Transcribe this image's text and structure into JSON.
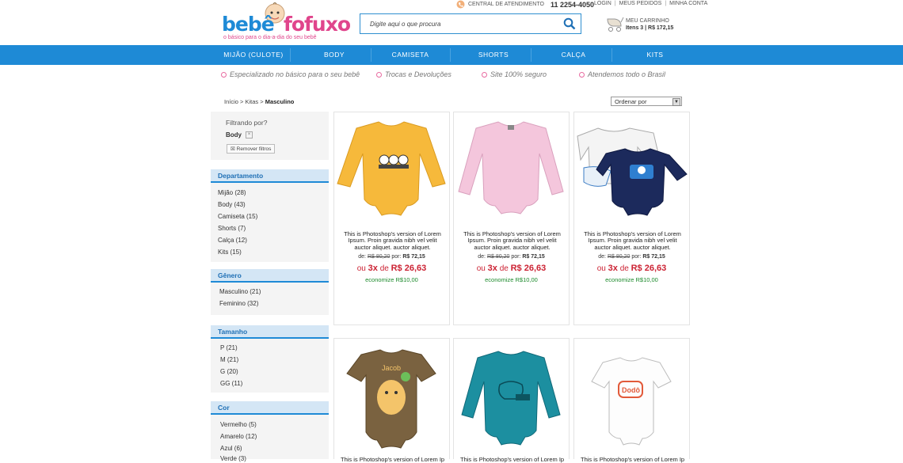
{
  "brand": {
    "part1": "bebê",
    "part2": "fofuxo",
    "tagline": "o básico para o dia-a-dia do seu bebê",
    "color1": "#1e8ad6",
    "color2": "#e0458c"
  },
  "header": {
    "service_label": "CENTRAL DE ATENDIMENTO",
    "service_phone": "11 2254-4050",
    "links": [
      "LOGIN",
      "MEUS PEDIDOS",
      "MINHA CONTA"
    ],
    "search_placeholder": "Digite aqui o que procura",
    "cart_label": "MEU CARRINHO",
    "cart_summary": "Itens 3 | R$ 172,15"
  },
  "nav": [
    "MIJÃO (CULOTE)",
    "BODY",
    "CAMISETA",
    "SHORTS",
    "CALÇA",
    "KITS"
  ],
  "benefits": [
    "Especializado no básico para o seu bebê",
    "Trocas e Devoluções",
    "Site 100% seguro",
    "Atendemos todo o Brasil"
  ],
  "breadcrumb": {
    "home": "Início >",
    "level1": "Kitas >",
    "current": "Masculino"
  },
  "order_by": "Ordenar por",
  "filter": {
    "title": "Filtrando por?",
    "active": "Body",
    "remove": "Remover filtros"
  },
  "sidebar": {
    "departamento": {
      "title": "Departamento",
      "items": [
        "Mijão (28)",
        "Body (43)",
        "Camiseta (15)",
        "Shorts (7)",
        "Calça (12)",
        "Kits (15)"
      ]
    },
    "genero": {
      "title": "Gênero",
      "items": [
        "Masculino (21)",
        "Feminino (32)"
      ]
    },
    "tamanho": {
      "title": "Tamanho",
      "items": [
        "P (21)",
        "M (21)",
        "G (20)",
        "GG (11)"
      ]
    },
    "cor": {
      "title": "Cor",
      "items": [
        "Vermelho (5)",
        "Amarelo (12)",
        "Azul (6)",
        "Verde (3)"
      ]
    }
  },
  "products": [
    {
      "desc": "This is Photoshop's version  of Lorem Ipsum. Proin gravida nibh vel velit auctor aliquet.  auctor aliquet.",
      "de_label": "de:",
      "old_price": "R$ 80,20",
      "por_label": "por:",
      "new_price": "R$ 72,15",
      "ou": "ou",
      "installments": "3x",
      "de2": "de",
      "installment_price": "R$ 26,63",
      "save": "economize R$10,00",
      "color": "#f6b93b"
    },
    {
      "desc": "This is Photoshop's version  of Lorem Ipsum. Proin gravida nibh vel velit auctor aliquet.  auctor aliquet.",
      "de_label": "de:",
      "old_price": "R$ 80,20",
      "por_label": "por:",
      "new_price": "R$ 72,15",
      "ou": "ou",
      "installments": "3x",
      "de2": "de",
      "installment_price": "R$ 26,63",
      "save": "economize R$10,00",
      "color": "#f4c6dc"
    },
    {
      "desc": "This is Photoshop's version  of Lorem Ipsum. Proin gravida nibh vel velit auctor aliquet.  auctor aliquet.",
      "de_label": "de:",
      "old_price": "R$ 80,20",
      "por_label": "por:",
      "new_price": "R$ 72,15",
      "ou": "ou",
      "installments": "3x",
      "de2": "de",
      "installment_price": "R$ 26,63",
      "save": "economize R$10,00",
      "color": "#1c2a5c"
    },
    {
      "desc": "This is Photoshop's version  of Lorem Ipsum.",
      "color": "#7a6240"
    },
    {
      "desc": "This is Photoshop's version  of Lorem Ipsum.",
      "color": "#1c8fa0"
    },
    {
      "desc": "This is Photoshop's version  of Lorem Ipsum.",
      "color": "#ffffff"
    }
  ]
}
